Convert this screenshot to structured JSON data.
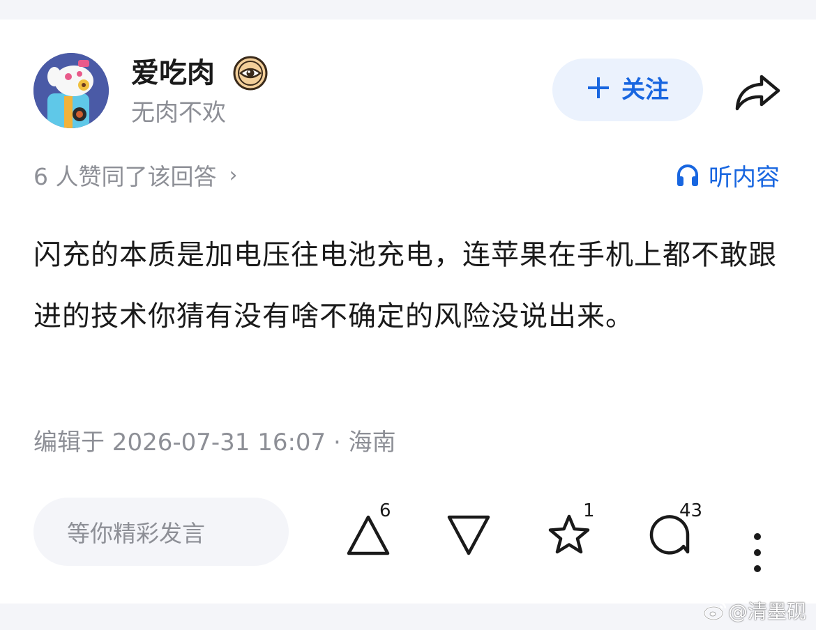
{
  "author": {
    "name": "爱吃肉",
    "bio": "无肉不欢",
    "badge_icon": "eye-medal-icon"
  },
  "header_actions": {
    "follow_label": "关注",
    "follow_icon": "plus-icon",
    "share_icon": "share-arrow-icon"
  },
  "stats": {
    "likes_text": "6 人赞同了该回答",
    "chevron": "›",
    "listen_label": "听内容",
    "listen_icon": "headphones-icon"
  },
  "answer": {
    "text": "闪充的本质是加电压往电池充电，连苹果在手机上都不敢跟进的技术你猜有没有啥不确定的风险没说出来。"
  },
  "meta": {
    "edit_text": "编辑于 2026-07-31 16:07 · 海南"
  },
  "bottom_bar": {
    "comment_placeholder": "等你精彩发言",
    "upvote_count": "6",
    "downvote_icon": "downvote-icon",
    "favorite_count": "1",
    "comment_count": "43",
    "more_icon": "more-vertical-icon"
  },
  "watermark": {
    "text": "@清墨砚",
    "icon": "weibo-icon"
  },
  "colors": {
    "accent": "#1866e0",
    "follow_bg": "#ebf2fd",
    "text_primary": "#1a1a1a",
    "text_secondary": "#8d8f96",
    "page_bg": "#f4f5f9"
  }
}
